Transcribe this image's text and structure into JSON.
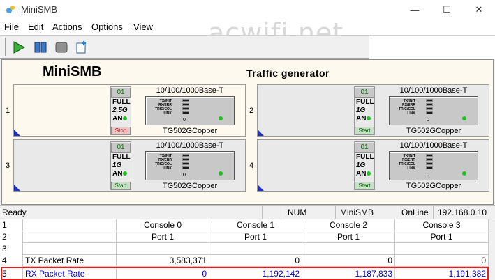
{
  "window": {
    "title": "MiniSMB",
    "minimize_glyph": "—",
    "maximize_glyph": "☐",
    "close_glyph": "✕"
  },
  "menu": [
    {
      "label": "File",
      "accel": "F",
      "rest": "ile"
    },
    {
      "label": "Edit",
      "accel": "E",
      "rest": "dit"
    },
    {
      "label": "Actions",
      "accel": "A",
      "rest": "ctions"
    },
    {
      "label": "Options",
      "accel": "O",
      "rest": "ptions"
    },
    {
      "label": "View",
      "accel": "V",
      "rest": "iew"
    }
  ],
  "watermark": "acwifi.net",
  "toolbar_icons": [
    "play-icon",
    "pause-icon",
    "stop-icon",
    "new-icon"
  ],
  "panel": {
    "title": "MiniSMB",
    "subtitle": "Traffic generator"
  },
  "slots": [
    {
      "slot": "1",
      "num": "01",
      "l1": "FULL",
      "l2": "2.5G",
      "l3": "AN",
      "state": "Stop",
      "card_type": "10/100/1000Base-T",
      "card_name": "TG502GCopper",
      "count": "0",
      "active": true
    },
    {
      "slot": "2",
      "num": "01",
      "l1": "FULL",
      "l2": "1G",
      "l3": "AN",
      "state": "Start",
      "card_type": "10/100/1000Base-T",
      "card_name": "TG502GCopper",
      "count": "0",
      "active": false
    },
    {
      "slot": "3",
      "num": "01",
      "l1": "FULL",
      "l2": "1G",
      "l3": "AN",
      "state": "Start",
      "card_type": "10/100/1000Base-T",
      "card_name": "TG502GCopper",
      "count": "0",
      "active": false
    },
    {
      "slot": "4",
      "num": "01",
      "l1": "FULL",
      "l2": "1G",
      "l3": "AN",
      "state": "Start",
      "card_type": "10/100/1000Base-T",
      "card_name": "TG502GCopper",
      "count": "0",
      "active": false
    }
  ],
  "card_labels": [
    "TX/INIT",
    "RX/ERR",
    "TRIG/COL",
    "LINK"
  ],
  "status": {
    "ready": "Ready",
    "num": "NUM",
    "app": "MiniSMB",
    "online": "OnLine",
    "ip": "192.168.0.10"
  },
  "grid": {
    "rows": [
      {
        "n": "1",
        "label": "",
        "c": [
          "Console 0",
          "Console 1",
          "Console 2",
          "Console 3"
        ]
      },
      {
        "n": "2",
        "label": "",
        "c": [
          "Port 1",
          "Port 1",
          "Port 1",
          "Port 1"
        ]
      },
      {
        "n": "3",
        "label": "",
        "c": [
          "",
          "",
          "",
          ""
        ]
      },
      {
        "n": "4",
        "label": "TX Packet Rate",
        "c": [
          "3,583,371",
          "0",
          "0",
          "0"
        ]
      },
      {
        "n": "5",
        "label": "RX Packet Rate",
        "c": [
          "0",
          "1,192,142",
          "1,187,833",
          "1,191,382"
        ]
      }
    ]
  },
  "colors": {
    "rx_text": "#0000c8",
    "highlight": "#e02020",
    "led_green": "#20c020",
    "stop_red": "#c00000"
  }
}
